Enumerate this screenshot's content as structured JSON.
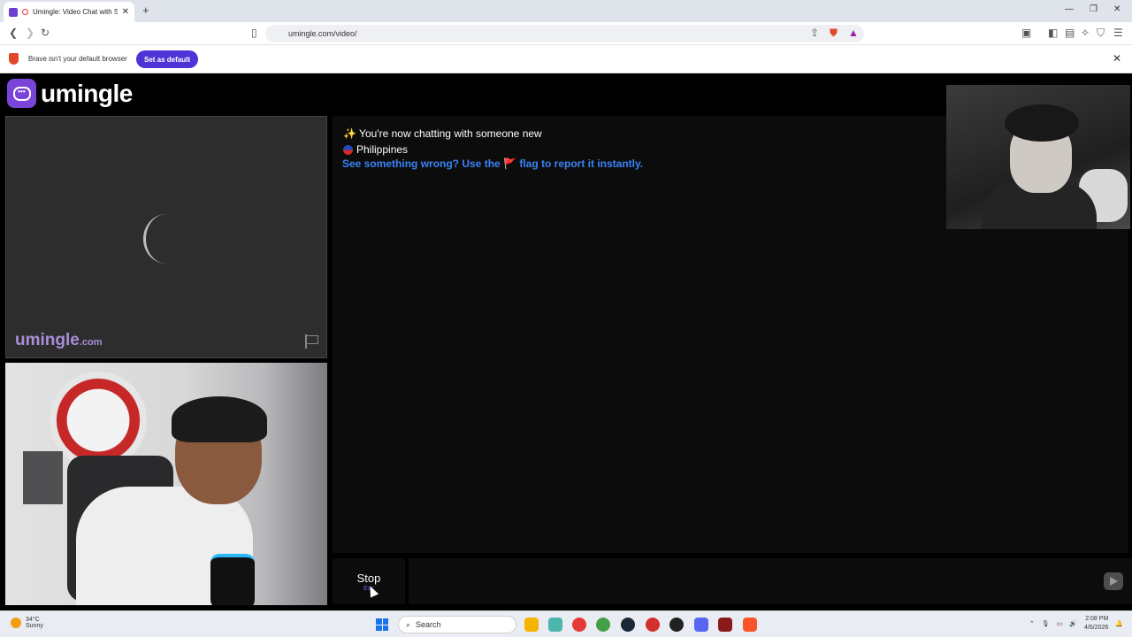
{
  "browser": {
    "tab_title": "Umingle: Video Chat with Str...",
    "tab_close": "✕",
    "new_tab": "+",
    "url": "umingle.com/video/",
    "window_controls": [
      "—",
      "❐",
      "✕"
    ]
  },
  "infobar": {
    "message": "Brave isn't your default browser",
    "button": "Set as default",
    "close": "✕"
  },
  "site": {
    "logo_text": "umingle",
    "watermark": "umingle",
    "watermark_suffix": ".com"
  },
  "chat": {
    "status_line": "✨ You're now chatting with someone new",
    "country": "Philippines",
    "report_prefix": "See something wrong? Use the ",
    "report_flag": "🚩",
    "report_suffix": " flag to report it instantly."
  },
  "controls": {
    "stop_label": "Stop",
    "stop_hint": "Esc"
  },
  "taskbar": {
    "temperature": "34°C",
    "weather": "Sunny",
    "search_label": "Search",
    "time": "2:08 PM",
    "date": "4/6/2026"
  },
  "colors": {
    "brand": "#7a44d8",
    "link": "#3b82f6",
    "set_default": "#5033d6"
  }
}
